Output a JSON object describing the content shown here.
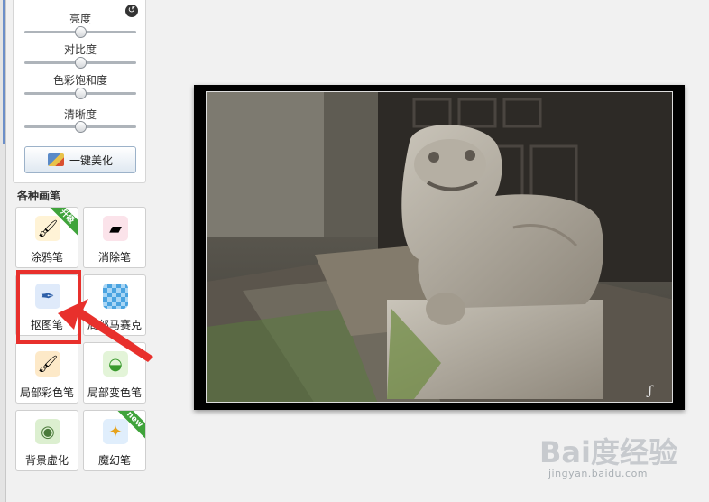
{
  "adjust_panel": {
    "sliders": [
      {
        "label": "亮度",
        "value": 0.5
      },
      {
        "label": "对比度",
        "value": 0.5
      },
      {
        "label": "色彩饱和度",
        "value": 0.5
      },
      {
        "label": "清晰度",
        "value": 0.5
      }
    ],
    "beautify_label": "一键美化",
    "reset_icon": "reset-icon"
  },
  "brushes": {
    "title": "各种画笔",
    "items": [
      {
        "label": "涂鸦笔",
        "icon": "paintbrush-icon",
        "badge": "升级"
      },
      {
        "label": "消除笔",
        "icon": "eraser-icon",
        "badge": ""
      },
      {
        "label": "抠图笔",
        "icon": "cutout-pen-icon",
        "badge": ""
      },
      {
        "label": "局部马赛克",
        "icon": "mosaic-icon",
        "badge": ""
      },
      {
        "label": "局部彩色笔",
        "icon": "color-brush-icon",
        "badge": ""
      },
      {
        "label": "局部变色笔",
        "icon": "recolor-brush-icon",
        "badge": ""
      },
      {
        "label": "背景虚化",
        "icon": "blur-background-icon",
        "badge": ""
      },
      {
        "label": "魔幻笔",
        "icon": "magic-pen-icon",
        "badge": "new"
      }
    ]
  },
  "colors": {
    "highlight": "#e8302c",
    "badge_green": "#3fa33b",
    "frame": "#000000"
  },
  "watermark": {
    "logo": "Bai度经验",
    "url": "jingyan.baidu.com"
  }
}
